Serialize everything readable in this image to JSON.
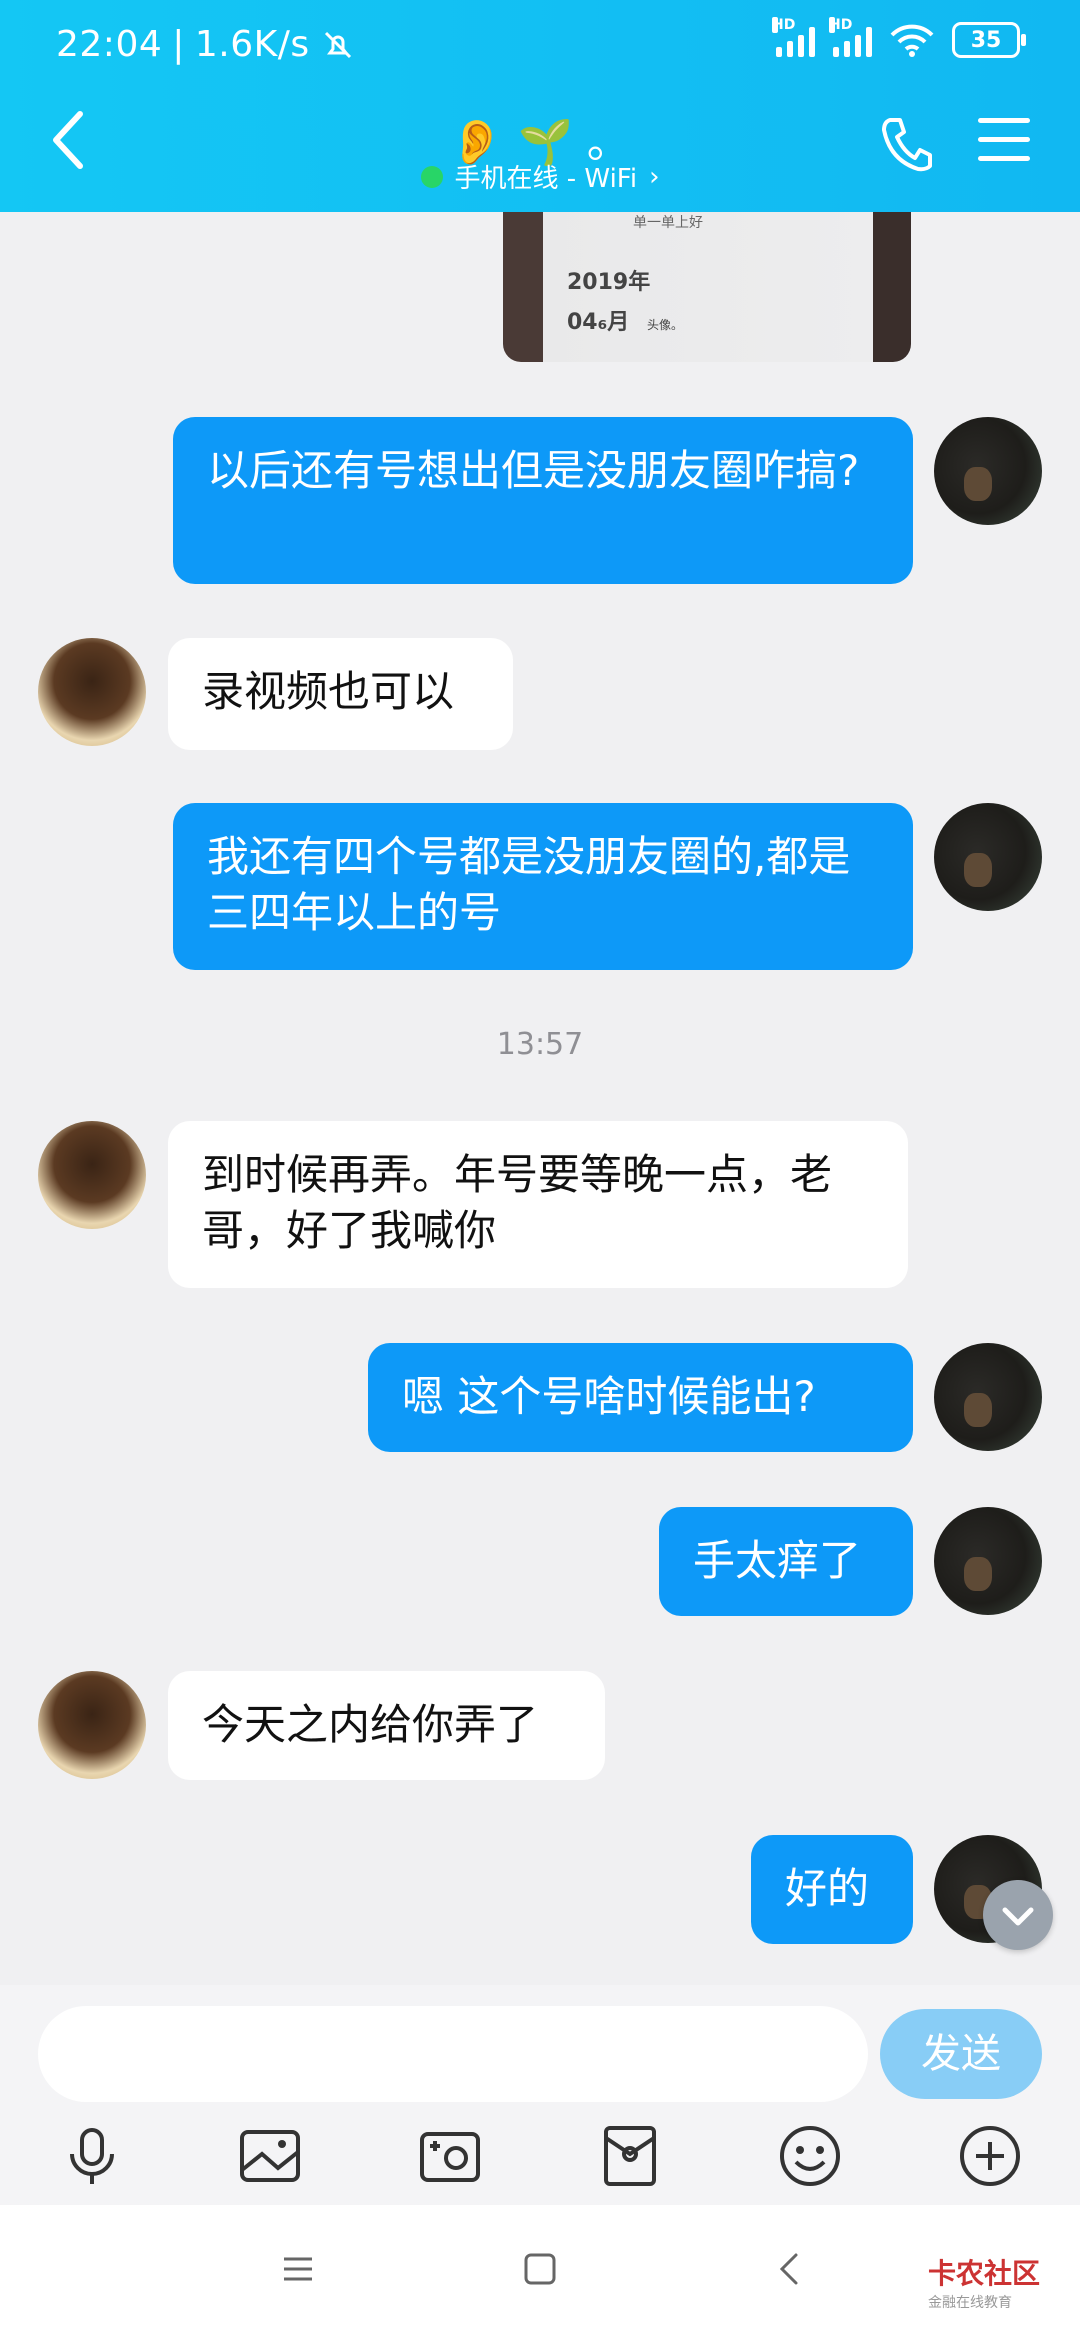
{
  "status_bar": {
    "time": "22:04",
    "speed": "1.6K/s",
    "network_badge_1": "HD",
    "network_badge_2": "HD",
    "battery": "35",
    "icons": [
      "mute-bell-icon",
      "signal-icon",
      "signal-icon",
      "wifi-icon",
      "battery-icon"
    ]
  },
  "header": {
    "title": "👂 🌱 。",
    "online_status": "手机在线 - WiFi",
    "online_chevron": "›"
  },
  "image_message": {
    "caption_top": "单一单上好",
    "year": "2019年",
    "date": "04₆月",
    "date_note": "头像。"
  },
  "messages": [
    {
      "sender": "me",
      "text": "以后还有号想出但是没朋友圈咋搞?"
    },
    {
      "sender": "other",
      "text": "录视频也可以"
    },
    {
      "sender": "me",
      "text": "我还有四个号都是没朋友圈的,都是三四年以上的号"
    },
    {
      "sender": "other",
      "text": "到时候再弄。年号要等晚一点，老哥，好了我喊你"
    },
    {
      "sender": "me",
      "text": "嗯  这个号啥时候能出?"
    },
    {
      "sender": "me",
      "text": "手太痒了"
    },
    {
      "sender": "other",
      "text": "今天之内给你弄了"
    },
    {
      "sender": "me",
      "text": "好的"
    }
  ],
  "timestamp": "13:57",
  "input": {
    "value": "",
    "send_label": "发送"
  },
  "toolbar_icons": [
    "microphone-icon",
    "image-icon",
    "camera-icon",
    "red-packet-icon",
    "emoji-icon",
    "plus-icon"
  ],
  "nav_icons": [
    "menu-icon",
    "home-icon",
    "back-icon"
  ],
  "watermark": {
    "title": "卡农社区",
    "subtitle": "金融在线教育"
  },
  "colors": {
    "header": "#12bdf3",
    "my_bubble": "#0d99f8",
    "other_bubble": "#ffffff",
    "send_button": "#88cdf6"
  }
}
